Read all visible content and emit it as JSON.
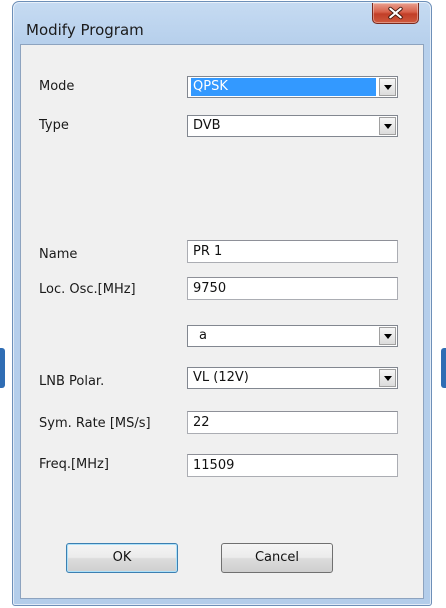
{
  "window": {
    "title": "Modify Program",
    "close_icon": "close-x-icon"
  },
  "form": {
    "mode": {
      "label": "Mode",
      "value": "QPSK"
    },
    "type": {
      "label": "Type",
      "value": "DVB"
    },
    "name": {
      "label": "Name",
      "value": "PR  1"
    },
    "loc_osc": {
      "label": "Loc. Osc.[MHz]",
      "value": "9750"
    },
    "band": {
      "value": "a"
    },
    "lnb_polar": {
      "label": "LNB Polar.",
      "value": "VL (12V)"
    },
    "sym_rate": {
      "label": "Sym. Rate [MS/s]",
      "value": "22"
    },
    "freq": {
      "label": "Freq.[MHz]",
      "value": "11509"
    }
  },
  "buttons": {
    "ok_label": "OK",
    "cancel_label": "Cancel"
  },
  "icons": {
    "dropdown": "chevron-down-icon"
  },
  "colors": {
    "titlebar": "#b9d1ec",
    "client": "#f0f0f0",
    "selection": "#3399ff",
    "close": "#c94a33"
  }
}
